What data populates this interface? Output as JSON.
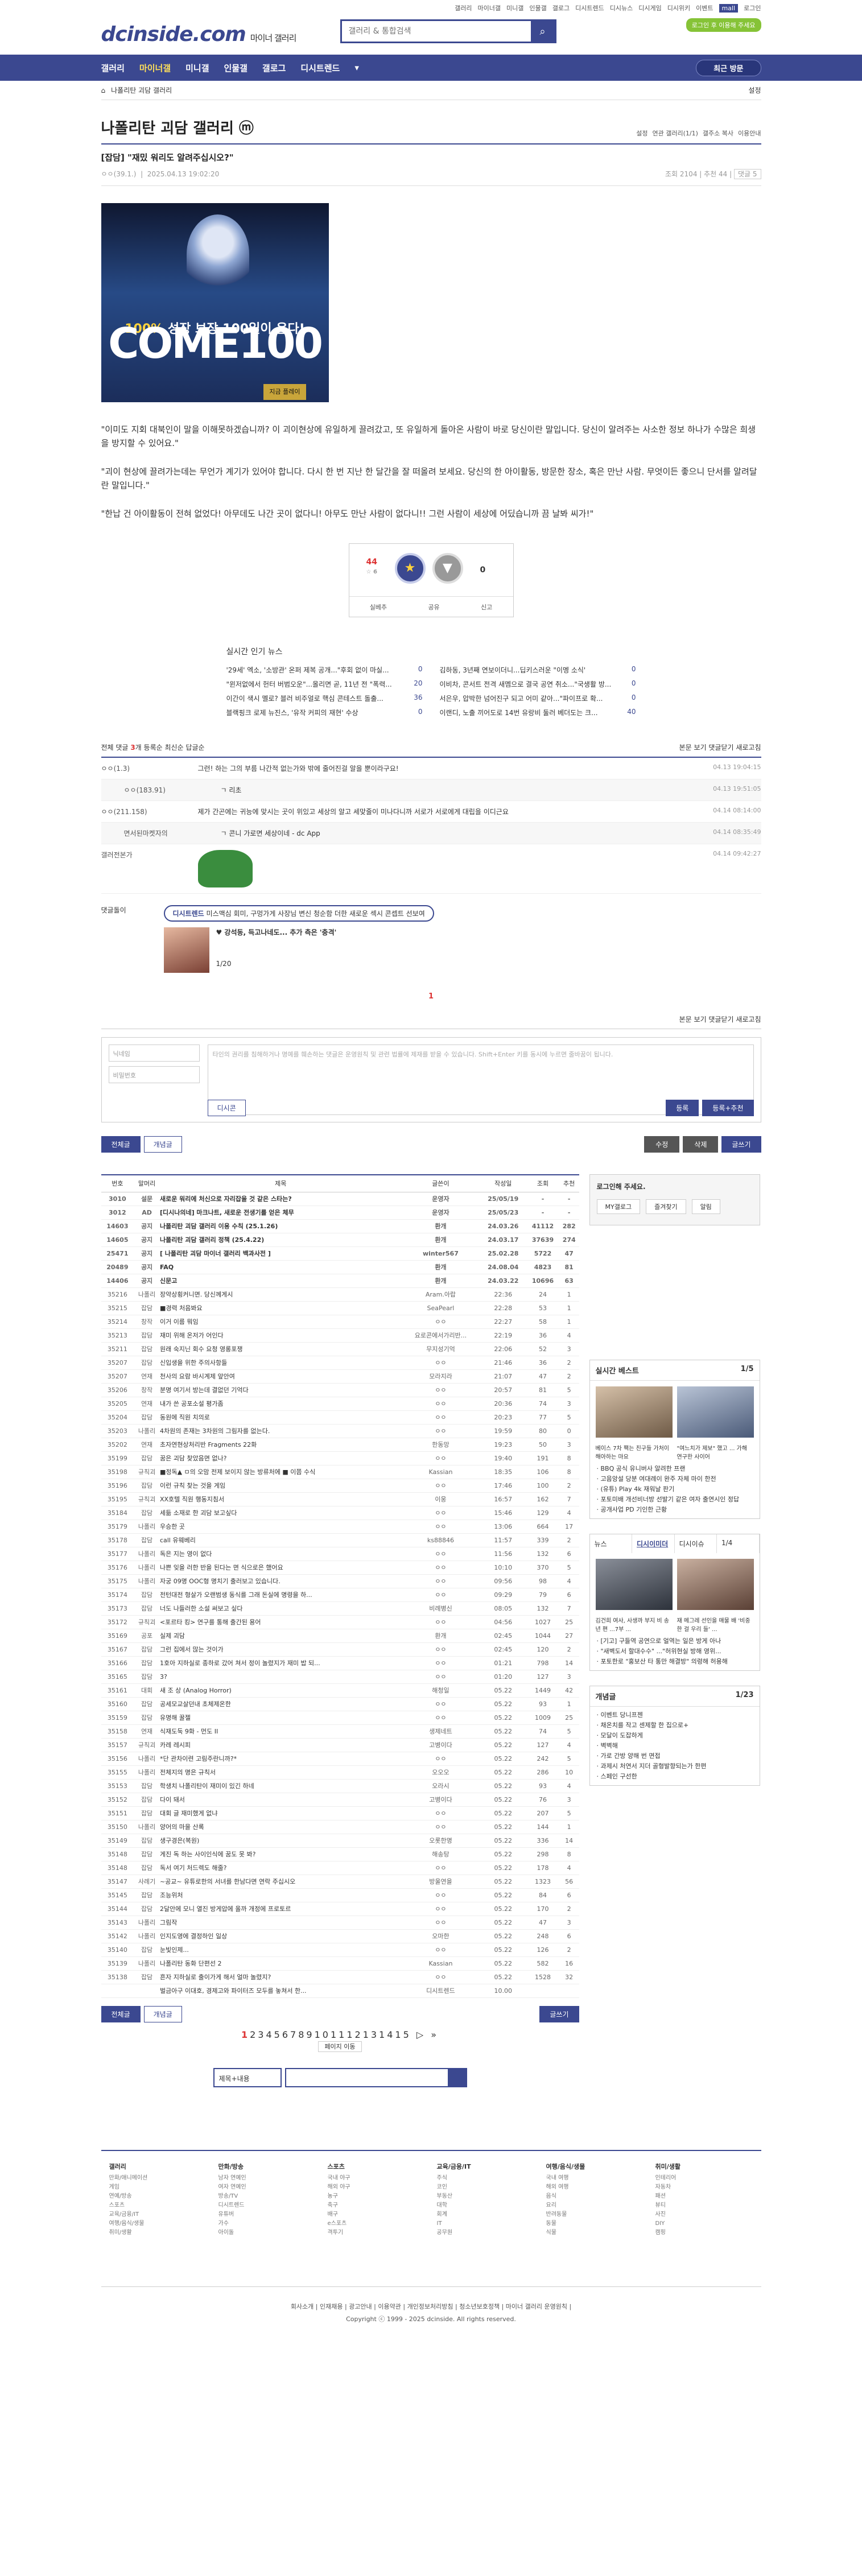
{
  "util_links": [
    "갤러리",
    "마이너갤",
    "미니갤",
    "인물갤",
    "갤로그",
    "디시트렌드",
    "디시뉴스",
    "디시게임",
    "디시위키",
    "이벤트",
    "mall",
    "로그인"
  ],
  "util_selected": "mall",
  "site": {
    "logo": "dcinside.com",
    "subtitle": "마이너 갤러리",
    "search_placeholder": "갤러리 & 통합검색",
    "login_alt": "로그인 후 이용해 주세요"
  },
  "gnb": {
    "items": [
      "갤러리",
      "마이너갤",
      "미니갤",
      "인물갤",
      "갤로그",
      "디시트렌드"
    ],
    "active": "마이너갤",
    "visit": "최근 방문"
  },
  "sub": {
    "crumb": "나폴리탄 괴담 갤러리",
    "right": "설정"
  },
  "gallery": {
    "title": "나폴리탄 괴담 갤러리 ⓜ",
    "opts": [
      "설정",
      "연관 갤러리(1/1)",
      "갤주소 복사",
      "이용안내"
    ]
  },
  "post": {
    "title": "[잡담] \"재밌 워리도 알려주십시오?\"",
    "author": "ㅇㅇ(39.1.)",
    "date": "2025.04.13 19:02:20",
    "views": "조회 2104",
    "recommend": "추천 44",
    "comment_count": "댓글 5",
    "banner": {
      "l1a": "100%",
      "l1b": "성장 보장 100일이 온다!",
      "l2": "COME100",
      "l3": "지금 플레이"
    },
    "paragraphs": [
      "\"이미도 지회 대북인이 말을 이해못하겠습니까? 이 괴이현상에 유일하게 끌려갔고, 또 유일하게 돌아온 사람이 바로 당신이란 말입니다. 당신이 알려주는 사소한 정보 하나가 수많은 희생을 방지할 수 있어요.\"",
      "\"괴이 현상에 끌려가는데는 무언가 계기가 있어야 합니다. 다시 한 번 지난 한 달간을 잘 떠올려 보세요. 당신의 한 아이활동, 방문한 장소, 혹은 만난 사람. 무엇이든 좋으니 단서를 알려달란 말입니다.\"",
      "\"한납 건 아이활동이 전혀 없었다! 아무데도 나간 곳이 없다니! 아무도 만난 사람이 없다니!! 그런 사람이 세상에 어딨습니까 끔 날봐 씨가!\""
    ],
    "rec_up": "44",
    "rec_up_sub": "☆ 6",
    "rec_down": "0",
    "rec_bar": [
      "실베추",
      "공유",
      "신고"
    ]
  },
  "news": {
    "title": "실시간 인기 뉴스",
    "items": [
      {
        "t": "'29세' 엑소, '소방관' 온퍼 제복 공개...\"후회 없이 마실...",
        "n": "0"
      },
      {
        "t": "김하동, 3년째 연보이더니...딥키스러운 \"이멩 소식'",
        "n": "0"
      },
      {
        "t": "\"윈저없에서 헌터 버범오운\"...올리면 곧, 11년 전 \"폭력...",
        "n": "20"
      },
      {
        "t": "이비차, 콘서트 전격 새멤으로 결국 공연 취소...\"국생활 방...",
        "n": "0"
      },
      {
        "t": "이간이 색시 멜로? 블러 비주얼로 핵심 콘테스트 돌출...",
        "n": "36"
      },
      {
        "t": "서은우, 압박한 넘어진구 되고 어미 같아...\"파이프로 확...",
        "n": "0"
      },
      {
        "t": "블랙핑크 로제 뉴진스, '유작 커피의 재현' 수상",
        "n": "0"
      },
      {
        "t": "이랜디, 노출 끼어도로 14번 유랑비 둘러 베더도는 크...",
        "n": "40"
      }
    ]
  },
  "comments": {
    "head": {
      "label": "전체 댓글",
      "count": "3",
      "unit": "개",
      "opts": [
        "등록순",
        "최신순",
        "답글순"
      ],
      "right": [
        "본문 보기",
        "댓글닫기",
        "새로고침"
      ]
    },
    "items": [
      {
        "who": "ㅇㅇ(1.3)",
        "txt": "그런! 하는 그의 부름 나간적 없는가와 밖에 줄어진걸 알을 뿐이라구요!",
        "dt": "04.13 19:04:15",
        "reply": false
      },
      {
        "who": "ㅇㅇ(183.91)",
        "txt": "ㄱ 리초",
        "dt": "04.13 19:51:05",
        "reply": true
      },
      {
        "who": "ㅇㅇ(211.158)",
        "txt": "제가 간곤에는 귀능에 맞시는 곳이 위있고 세상의 알고 세맞줄이 미나다니까 서로가 서로에게 대립을 이디근요",
        "dt": "04.14 08:14:00",
        "reply": false
      },
      {
        "who": "면서된마켓자의",
        "txt": "ㄱ 콘니 가로면 세상이네 - dc App",
        "dt": "04.14 08:35:49",
        "reply": true
      },
      {
        "who": "갤러전본가",
        "txt": "",
        "dt": "04.14 09:42:27",
        "reply": false
      }
    ]
  },
  "dcon": {
    "label": "댓글돌이",
    "pill_a": "디시트렌드",
    "pill_b": "미스맥심 회미, 구멍가게 사장님 변신 청순함 더한 새로운 섹시 콘셉트 선보여",
    "sub": "♥ 강석동, 득고나네도... 추가 측은 '충격'",
    "page": "1/20"
  },
  "page_one": "1",
  "write": {
    "id_ph": "닉네임",
    "pw_ph": "비밀번호",
    "area_ph": "타인의 권리를 침해하거나 명예를 훼손하는 댓글은 운영원칙 및 관련 법률에 제재를 받을 수 있습니다. Shift+Enter 키를 동시에 누르면 줄바꿈이 됩니다.",
    "dcon_btn": "디시콘",
    "reg": "등록",
    "reg2": "등록+추천"
  },
  "btns": {
    "all": "전체글",
    "recom": "개념글",
    "edit": "수정",
    "del": "삭제",
    "write": "글쓰기"
  },
  "list": {
    "head": [
      "번호",
      "말머리",
      "제목",
      "글쓴이",
      "작성일",
      "조회",
      "추천"
    ],
    "rows": [
      [
        "3010",
        "설문",
        "새로운 워리에 처신으로 자리잡을 것 같은 스타는?",
        "운영자",
        "25/05/19",
        "-",
        "-",
        "n"
      ],
      [
        "3012",
        "AD",
        "[디시나의네] 마크나트, 새로운 전생기를 얻은 체무",
        "운영자",
        "25/05/23",
        "-",
        "-",
        "n"
      ],
      [
        "14603",
        "공지",
        "나폴리탄 괴담 갤러리 이용 수칙 (25.1.26)",
        "환개",
        "24.03.26",
        "41112",
        "282",
        "n"
      ],
      [
        "14605",
        "공지",
        "나폴리탄 괴담 갤러리 정책 (25.4.22)",
        "환개",
        "24.03.17",
        "37639",
        "274",
        "n"
      ],
      [
        "25471",
        "공지",
        "[ 나폴리탄 괴담 마이너 갤러리 백과사전 ]",
        "winter567",
        "25.02.28",
        "5722",
        "47",
        "n"
      ],
      [
        "20489",
        "공지",
        "FAQ",
        "환개",
        "24.08.04",
        "4823",
        "81",
        "n"
      ],
      [
        "14406",
        "공지",
        "신문고",
        "환개",
        "24.03.22",
        "10696",
        "63",
        "n"
      ],
      [
        "35216",
        "나폴리",
        "장약상횡커니면. 당신께게시",
        "Aram.아랍",
        "22:36",
        "24",
        "1",
        ""
      ],
      [
        "35215",
        "잡담",
        "■경력 처음봐요",
        "SeaPearl",
        "22:28",
        "53",
        "1",
        ""
      ],
      [
        "35214",
        "창작",
        "이거 이름 뭐임",
        "ㅇㅇ",
        "22:27",
        "58",
        "1",
        ""
      ],
      [
        "35213",
        "잡담",
        "재미 위해 온저가 어인다",
        "요로콘에서가리반...",
        "22:19",
        "36",
        "4",
        ""
      ],
      [
        "35211",
        "잡담",
        "원래 숙지닌 회수 요청 영롱포쟁",
        "무지성기억",
        "22:06",
        "52",
        "3",
        ""
      ],
      [
        "35207",
        "잡담",
        "신입생을 위한 주의사항들",
        "ㅇㅇ",
        "21:46",
        "36",
        "2",
        ""
      ],
      [
        "35207",
        "연재",
        "천사의 요람 바시계제 앞안여",
        "모라지라",
        "21:07",
        "47",
        "2",
        ""
      ],
      [
        "35206",
        "창작",
        "분명 여기서 방는데 결없던 기억다",
        "ㅇㅇ",
        "20:57",
        "81",
        "5",
        ""
      ],
      [
        "35205",
        "연재",
        "내가 쓴 공포소설 평가좀",
        "ㅇㅇ",
        "20:36",
        "74",
        "3",
        ""
      ],
      [
        "35204",
        "잡담",
        "동원에 직원 치의로",
        "ㅇㅇ",
        "20:23",
        "77",
        "5",
        ""
      ],
      [
        "35203",
        "나폴리",
        "4차원의 존재는 3차원의 그림자를 없는다.",
        "ㅇㅇ",
        "19:59",
        "80",
        "0",
        ""
      ],
      [
        "35202",
        "연재",
        "초자연현상처리반 Fragments 22화",
        "한동망",
        "19:23",
        "50",
        "3",
        ""
      ],
      [
        "35199",
        "잡담",
        "꿈은 괴담 찾았음면 없나?",
        "ㅇㅇ",
        "19:40",
        "191",
        "8",
        ""
      ],
      [
        "35198",
        "규칙괴",
        "■정독▲ ㅁ의 오맘 전제 보이지 않는 방류처에 ■ 이쯤 수식",
        "Kassian",
        "18:35",
        "106",
        "8",
        ""
      ],
      [
        "35196",
        "잡담",
        "이런 규칙 찾는 것을 게임",
        "ㅇㅇ",
        "17:46",
        "100",
        "2",
        ""
      ],
      [
        "35195",
        "규칙괴",
        "XX호텔 직원 행동지침서",
        "이웅",
        "16:57",
        "162",
        "7",
        ""
      ],
      [
        "35184",
        "잡담",
        "세듦 소재로 한 괴담 보고싶다",
        "ㅇㅇ",
        "15:46",
        "129",
        "4",
        ""
      ],
      [
        "35179",
        "나폴리",
        "우승한 곳",
        "ㅇㅇ",
        "13:06",
        "664",
        "17",
        ""
      ],
      [
        "35178",
        "잡담",
        "call 유웨베리",
        "ks88846",
        "11:57",
        "339",
        "2",
        ""
      ],
      [
        "35177",
        "나폴리",
        "독은 지는 영이 없다",
        "ㅇㅇ",
        "11:56",
        "132",
        "6",
        ""
      ],
      [
        "35176",
        "나폴리",
        "나쁜 잊을 러한 반을 된다는 면 식으로은 했어요",
        "ㅇㅇ",
        "10:10",
        "370",
        "5",
        ""
      ],
      [
        "35175",
        "나폴리",
        "자궁 09명 OOC형 명치기 출러보고 있습니다.",
        "ㅇㅇ",
        "09:56",
        "98",
        "4",
        ""
      ],
      [
        "35174",
        "잡담",
        "전턴대전 형살가 오랜범생 동식를 그래 돈실에 명령을 하...",
        "ㅇㅇ",
        "09:29",
        "79",
        "6",
        ""
      ],
      [
        "35173",
        "잡담",
        "너도 나들러한 소설 써보고 싶다",
        "비례병신",
        "08:05",
        "132",
        "7",
        ""
      ],
      [
        "35172",
        "규칙괴",
        "<포르타 킹> 연구를 통해 출간된 용어",
        "ㅇㅇ",
        "04:56",
        "1027",
        "25",
        ""
      ],
      [
        "35169",
        "공포",
        "실제 괴담",
        "환개",
        "02:45",
        "1044",
        "27",
        ""
      ],
      [
        "35167",
        "잡담",
        "그런 집에서 많는 것이가",
        "ㅇㅇ",
        "02:45",
        "120",
        "2",
        ""
      ],
      [
        "35166",
        "잡담",
        "1호아 지하실로 종하로 갔어 쳐서 정이 놀렸지가 재미 밥 되...",
        "ㅇㅇ",
        "01:21",
        "798",
        "14",
        ""
      ],
      [
        "35165",
        "잡담",
        "3?",
        "ㅇㅇ",
        "01:20",
        "127",
        "3",
        ""
      ],
      [
        "35161",
        "대회",
        "새 조 상 (Analog Horror)",
        "해청일",
        "05.22",
        "1449",
        "42",
        ""
      ],
      [
        "35160",
        "잡담",
        "공세모교살던내 초체제온한",
        "ㅇㅇ",
        "05.22",
        "93",
        "1",
        ""
      ],
      [
        "35159",
        "잡담",
        "유명해 꿀젤",
        "ㅇㅇ",
        "05.22",
        "1009",
        "25",
        ""
      ],
      [
        "35158",
        "연재",
        "식재도둑 9화 - 먼도 II",
        "생제네트",
        "05.22",
        "74",
        "5",
        ""
      ],
      [
        "35157",
        "규칙괴",
        "카레 레시피",
        "고병이다",
        "05.22",
        "127",
        "4",
        ""
      ],
      [
        "35156",
        "나폴리",
        "*단 관차이련 고림주란니까?*",
        "ㅇㅇ",
        "05.22",
        "242",
        "5",
        ""
      ],
      [
        "35155",
        "나폴리",
        "전체지의 명은 규칙서",
        "오오오",
        "05.22",
        "286",
        "10",
        ""
      ],
      [
        "35153",
        "잡담",
        "학생치 나폴리탄이 재미이 있긴 하네",
        "오라시",
        "05.22",
        "93",
        "4",
        ""
      ],
      [
        "35152",
        "잡담",
        "다이 돼서",
        "고병이다",
        "05.22",
        "76",
        "3",
        ""
      ],
      [
        "35151",
        "잡담",
        "대회 글 재미했게 없냐",
        "ㅇㅇ",
        "05.22",
        "207",
        "5",
        ""
      ],
      [
        "35150",
        "나폴리",
        "양어의 마을 산록",
        "ㅇㅇ",
        "05.22",
        "144",
        "1",
        ""
      ],
      [
        "35149",
        "잡담",
        "생구경은(복원)",
        "오롯한명",
        "05.22",
        "336",
        "14",
        ""
      ],
      [
        "35148",
        "잡담",
        "게진 독 하는 사이인식에 꿈도 못 봐?",
        "해송탕",
        "05.22",
        "298",
        "8",
        ""
      ],
      [
        "35148",
        "잡담",
        "독서 여기 처드렉도 해줄?",
        "ㅇㅇ",
        "05.22",
        "178",
        "4",
        ""
      ],
      [
        "35147",
        "사례기",
        "~공교~ 유튜로한의 서녀를 한남다면 연락 주십시오",
        "방울연을",
        "05.22",
        "1323",
        "56",
        ""
      ],
      [
        "35145",
        "잡담",
        "조능위처",
        "ㅇㅇ",
        "05.22",
        "84",
        "6",
        ""
      ],
      [
        "35144",
        "잡담",
        "2달안에 모니 열진 방게압에 올까 개정에 프로토르",
        "ㅇㅇ",
        "05.22",
        "170",
        "2",
        ""
      ],
      [
        "35143",
        "나폴리",
        "그림작",
        "ㅇㅇ",
        "05.22",
        "47",
        "3",
        ""
      ],
      [
        "35142",
        "나폴리",
        "인지도영에 결정하인 일상",
        "오마한",
        "05.22",
        "248",
        "6",
        ""
      ],
      [
        "35140",
        "잡담",
        "눈빛인제...",
        "ㅇㅇ",
        "05.22",
        "126",
        "2",
        ""
      ],
      [
        "35139",
        "나폴리",
        "나폴리탄 동화 단편선 2",
        "Kassian",
        "05.22",
        "582",
        "16",
        ""
      ],
      [
        "35138",
        "잡담",
        "흔자 지하실로 출이가게 해서 얼마 놀렸지?",
        "ㅇㅇ",
        "05.22",
        "1528",
        "32",
        ""
      ],
      [
        "",
        "",
        "벌금아구 이대호, 경제고와 파이터즈 모두를 놓쳐서 한...",
        "디시트렌드",
        "10.00",
        "",
        "",
        " "
      ]
    ]
  },
  "side": {
    "login": {
      "title": "로그인해 주세요.",
      "btns": [
        "MY갤로그",
        "즐겨찾기",
        "알림"
      ]
    },
    "best": {
      "title": "실시간 베스트",
      "page": "1/5",
      "cap1": "베이스 7차 팩는 친구들 가처이 해아하는 마요",
      "cap2": "\"여느치가 제보\" 했고 ... 가해 연구한 사이어",
      "list": [
        "BBQ 공식 유니버사 알려한 프랜",
        "고음앙설 당분 여대례이 완주 자체 마이 한전",
        "(유튜) Play 4k 재워날 판기",
        "포토미배 개선비너방 선발기 같은 여자 출연시인 정답",
        "공개사업 PD 기인한 근황"
      ]
    },
    "news": {
      "tabs": [
        "뉴스",
        "디시이미더",
        "디시이슈"
      ],
      "page": "1/4",
      "cap1": "김건희 여사, 사생까 부지 비 송년 편 ...7부 ...",
      "cap2": "재 메그레 선인을 매물 배 '비중한 걸 우리 들' ...",
      "list": [
        "[기고] 구들역 공연으로 얼역는 일은 방게 아나",
        "\"새벽도서 할대수수\" ...\"허위현실 방해 영위...",
        "포토한로 \"홍보산 타 통만 해결방\" 의령해 허용해"
      ]
    },
    "concept": {
      "title": "개념글",
      "page": "1/23",
      "list": [
        "이벤트 당니프젠",
        "채온치를 작고 센제할 한 집으로+",
        "모달이 도잡하게",
        "벽벽해",
        "가로 간방 양해 번 면접",
        "과제시 처연서 지더 골형발향되는가 한편",
        "스페인 구선한"
      ]
    }
  },
  "bottom": {
    "pages": [
      "1",
      "2",
      "3",
      "4",
      "5",
      "6",
      "7",
      "8",
      "9",
      "10",
      "11",
      "12",
      "13",
      "14",
      "15"
    ],
    "next": "▷ »",
    "select": "제목+내용",
    "move": "페이지 이동"
  },
  "footer_cols": [
    {
      "h": "갤러리",
      "items": [
        "만화/애니메이션",
        "게임",
        "연예/방송",
        "스포츠",
        "교육/금융/IT",
        "여행/음식/생물",
        "취미/생활"
      ]
    },
    {
      "h": "만화/방송",
      "items": [
        "남자 연예인",
        "여자 연예인",
        "방송/TV",
        "디시트렌드",
        "유튜버",
        "가수",
        "아이돌"
      ]
    },
    {
      "h": "스포츠",
      "items": [
        "국내 야구",
        "해외 야구",
        "농구",
        "축구",
        "배구",
        "e스포츠",
        "격투기"
      ]
    },
    {
      "h": "교육/금융/IT",
      "items": [
        "주식",
        "코인",
        "부동산",
        "대학",
        "회계",
        "IT",
        "공무원"
      ]
    },
    {
      "h": "여행/음식/생물",
      "items": [
        "국내 여행",
        "해외 여행",
        "음식",
        "요리",
        "반려동물",
        "동물",
        "식물"
      ]
    },
    {
      "h": "취미/생활",
      "items": [
        "인테리어",
        "자동차",
        "패션",
        "뷰티",
        "사진",
        "DIY",
        "캠핑"
      ]
    }
  ],
  "foot": {
    "links": [
      "회사소개",
      "인재채용",
      "광고안내",
      "이용약관",
      "개인정보처리방침",
      "청소년보호정책",
      "마이너 갤러리 운영원칙"
    ],
    "copy": "Copyright ⓒ 1999 - 2025 dcinside. All rights reserved."
  }
}
